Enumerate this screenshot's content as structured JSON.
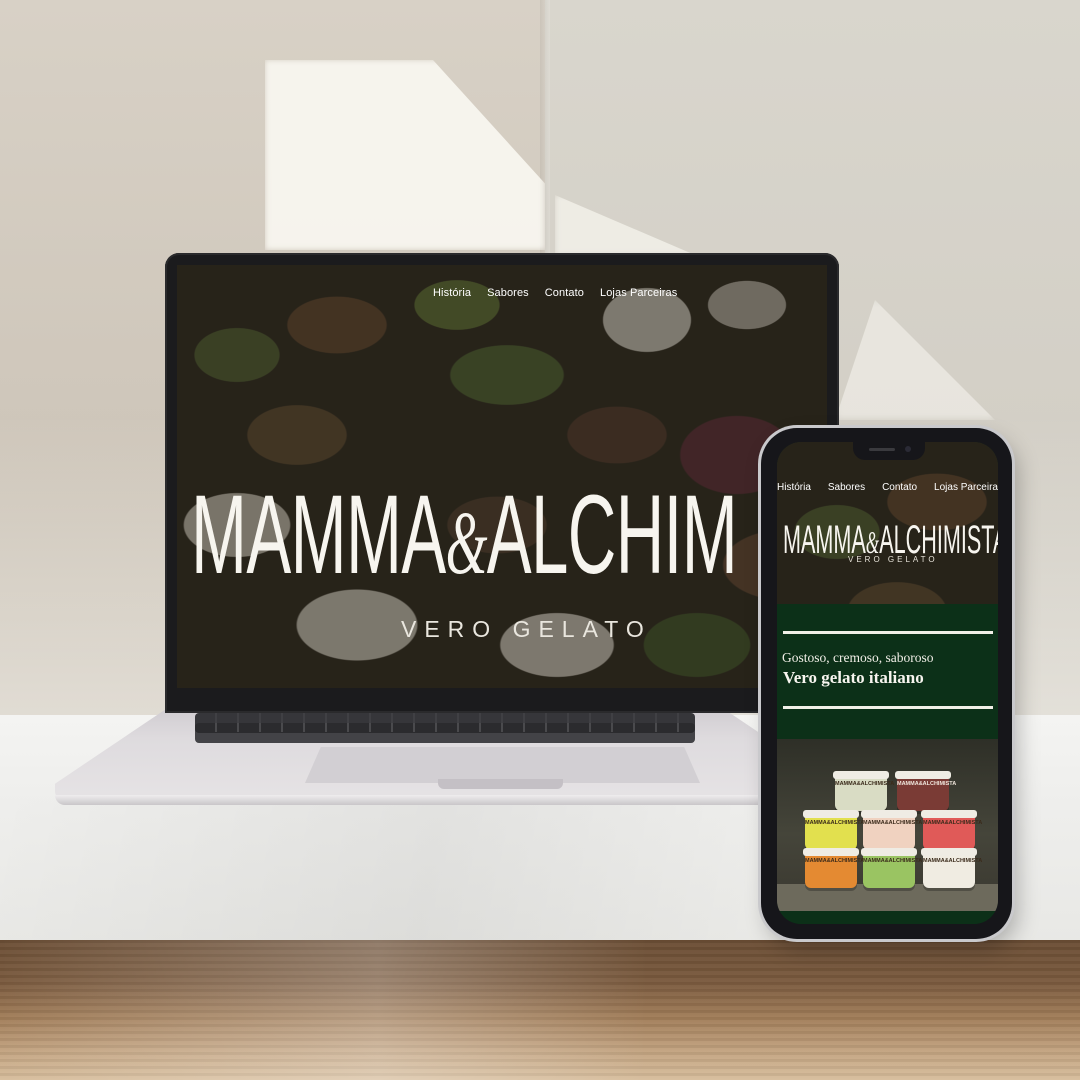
{
  "laptop_site": {
    "nav": [
      "História",
      "Sabores",
      "Contato",
      "Lojas Parceiras"
    ],
    "logo_left": "MAMMA",
    "logo_amp": "&",
    "logo_right": "ALCHIM",
    "tagline": "VERO GELATO"
  },
  "phone_site": {
    "nav": [
      "História",
      "Sabores",
      "Contato",
      "Lojas Parceira"
    ],
    "logo_left": "MAMMA",
    "logo_amp": "&",
    "logo_right": "ALCHIMISTA",
    "tagline": "VERO GELATO",
    "subheadline": "Gostoso, cremoso, saboroso",
    "headline": "Vero gelato italiano",
    "product_label": "MAMMA&ALCHIMISTA"
  },
  "colors": {
    "brand_green": "#0c3018",
    "logo_cream": "#f7f5ef",
    "cups": [
      "#d9dcc4",
      "#7a3b35",
      "#e2e04e",
      "#f0d2c0",
      "#e05a58",
      "#e48a32",
      "#9ac462",
      "#f0ece2"
    ]
  },
  "icons": [
    "phone-camera-icon",
    "phone-speaker-icon"
  ]
}
